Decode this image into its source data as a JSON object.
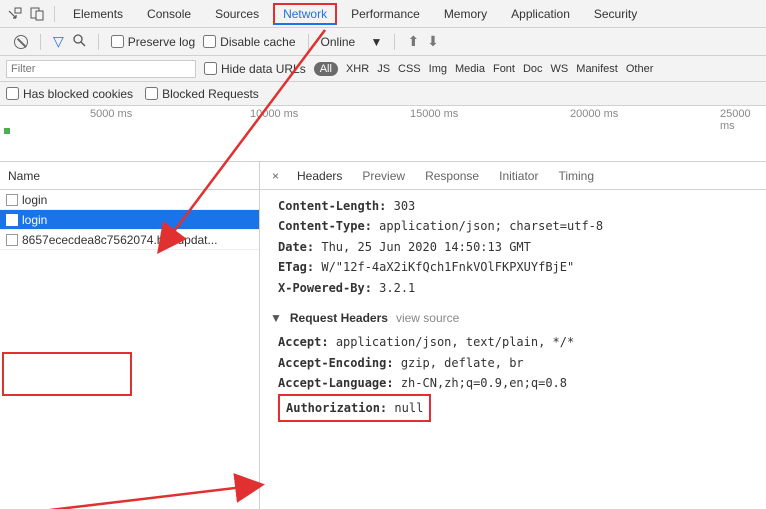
{
  "tabs": {
    "elements": "Elements",
    "console": "Console",
    "sources": "Sources",
    "network": "Network",
    "performance": "Performance",
    "memory": "Memory",
    "application": "Application",
    "security": "Security"
  },
  "toolbar2": {
    "preserve_log": "Preserve log",
    "disable_cache": "Disable cache",
    "online": "Online"
  },
  "filterbar": {
    "placeholder": "Filter",
    "hide_data_urls": "Hide data URLs",
    "all": "All",
    "types": [
      "XHR",
      "JS",
      "CSS",
      "Img",
      "Media",
      "Font",
      "Doc",
      "WS",
      "Manifest",
      "Other"
    ]
  },
  "filterbar2": {
    "blocked_cookies": "Has blocked cookies",
    "blocked_requests": "Blocked Requests"
  },
  "timeline": {
    "t1": "5000 ms",
    "t2": "10000 ms",
    "t3": "15000 ms",
    "t4": "20000 ms",
    "t5": "25000 ms"
  },
  "left": {
    "header": "Name",
    "rows": [
      {
        "label": "login"
      },
      {
        "label": "login"
      },
      {
        "label": "8657ececdea8c7562074.hot-updat..."
      }
    ]
  },
  "right": {
    "tabs": {
      "headers": "Headers",
      "preview": "Preview",
      "response": "Response",
      "initiator": "Initiator",
      "timing": "Timing"
    },
    "resp": {
      "content_length_key": "Content-Length:",
      "content_length": "303",
      "content_type_key": "Content-Type:",
      "content_type": "application/json; charset=utf-8",
      "date_key": "Date:",
      "date": "Thu, 25 Jun 2020 14:50:13 GMT",
      "etag_key": "ETag:",
      "etag": "W/\"12f-4aX2iKfQch1FnkVOlFKPXUYfBjE\"",
      "xpb_key": "X-Powered-By:",
      "xpb": "3.2.1"
    },
    "reqh": {
      "title": "Request Headers",
      "view_source": "view source",
      "accept_key": "Accept:",
      "accept": "application/json, text/plain, */*",
      "ae_key": "Accept-Encoding:",
      "ae": "gzip, deflate, br",
      "al_key": "Accept-Language:",
      "al": "zh-CN,zh;q=0.9,en;q=0.8",
      "auth_key": "Authorization:",
      "auth": "null"
    }
  }
}
